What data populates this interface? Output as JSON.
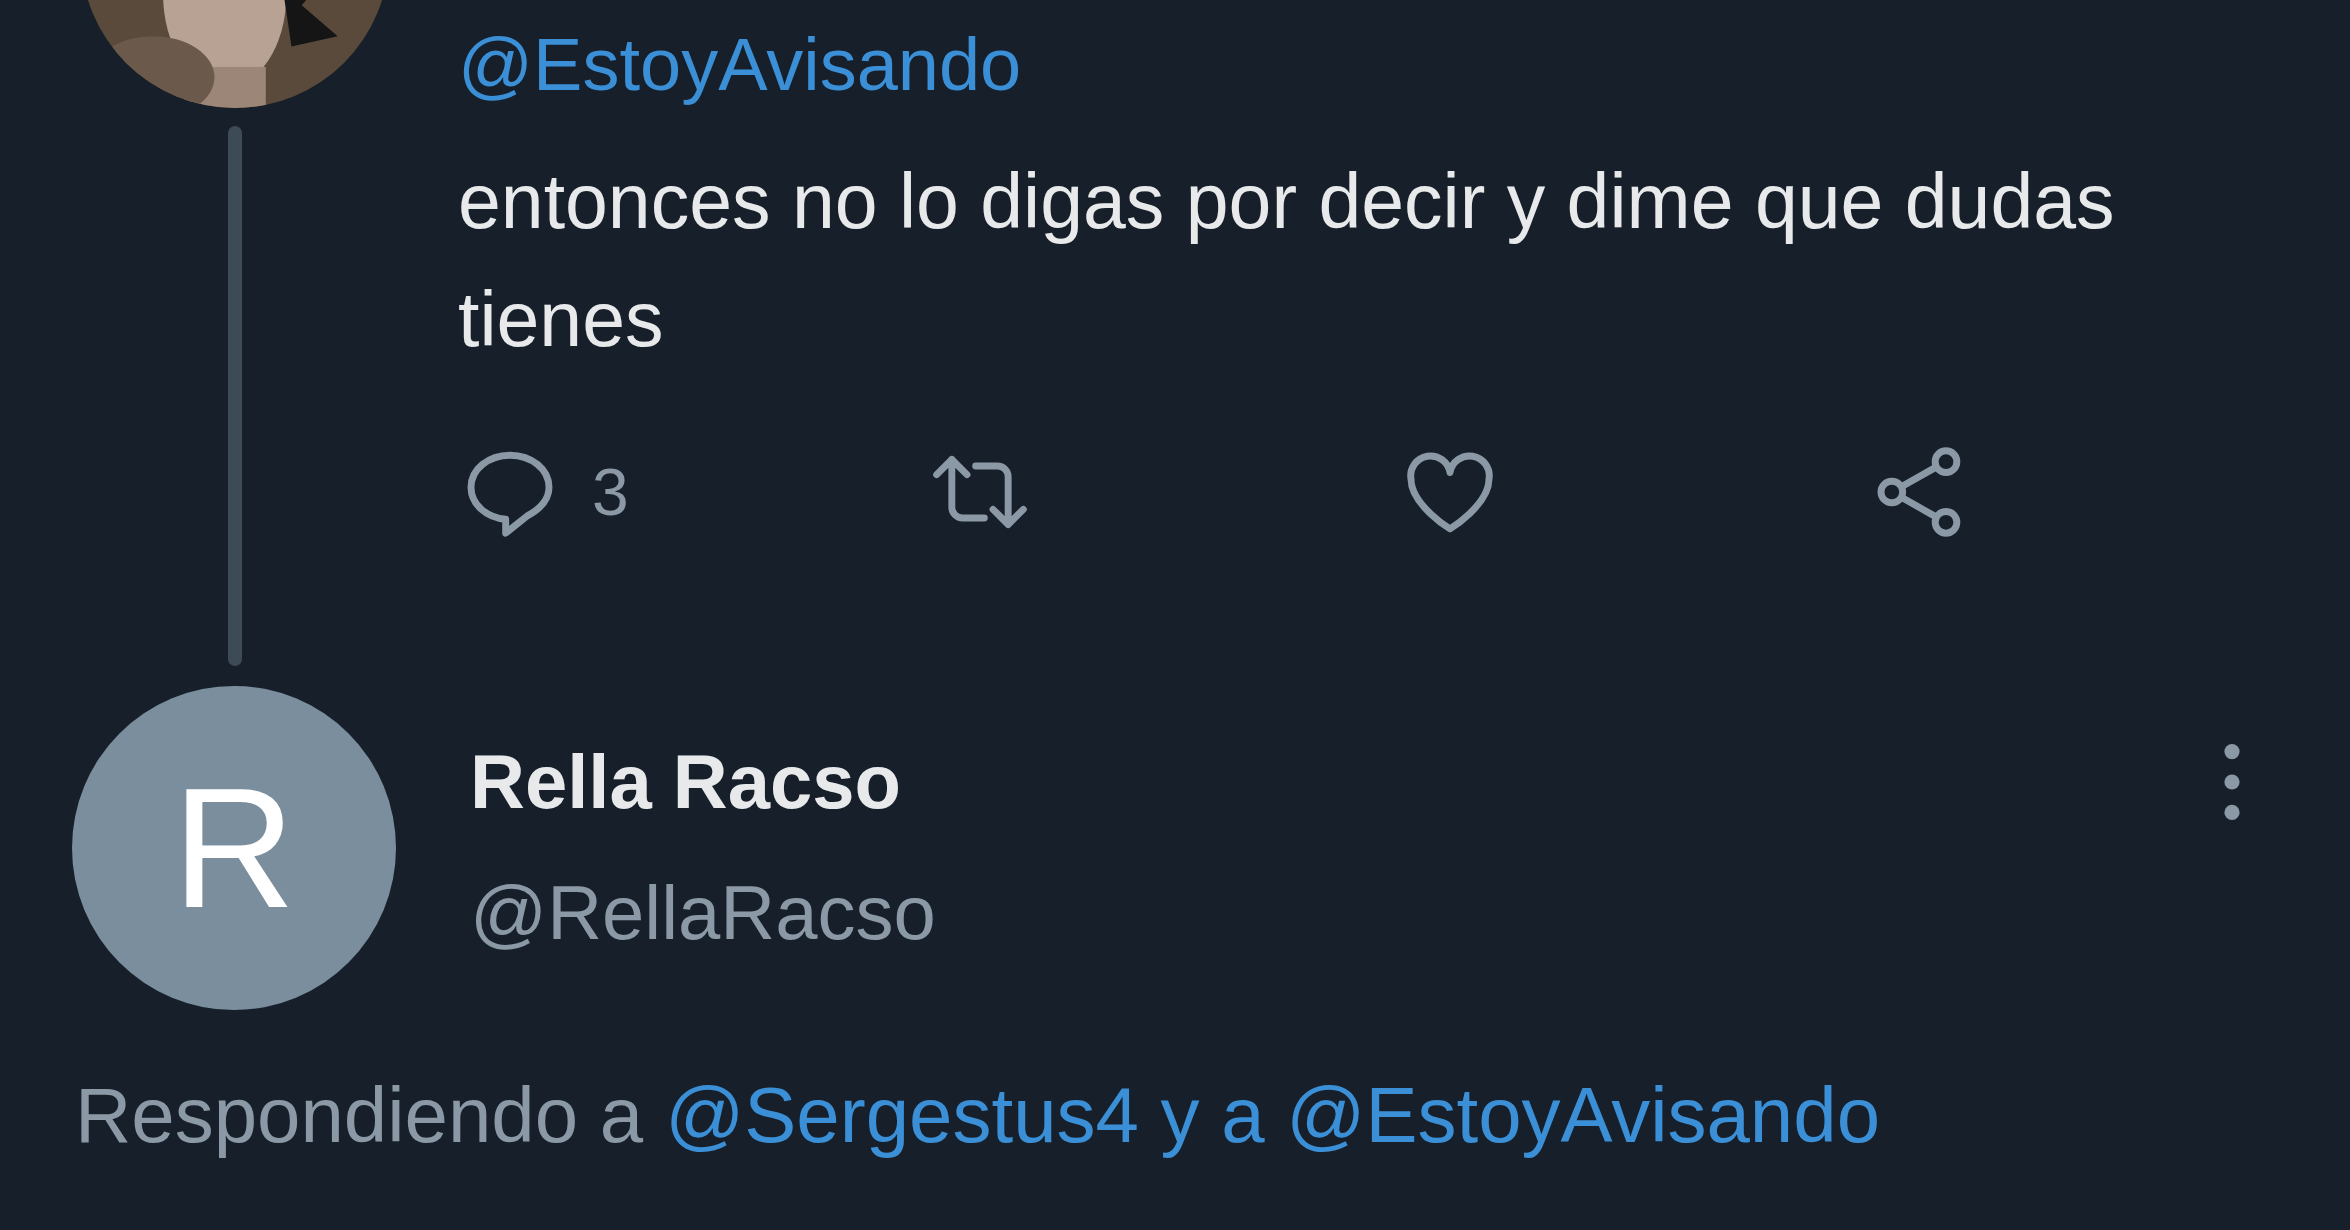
{
  "tweet": {
    "handle": "@EstoyAvisando",
    "text": "entonces no lo digas por decir y dime que dudas tienes",
    "actions": [
      {
        "kind": "reply",
        "count": "3"
      },
      {
        "kind": "retweet"
      },
      {
        "kind": "like"
      },
      {
        "kind": "share"
      }
    ]
  },
  "reply": {
    "avatar_letter": "R",
    "name": "Rella Racso",
    "handle": "@RellaRacso",
    "replying_prefix": "Respondiendo a",
    "replying_to": "@Sergestus4 y a @EstoyAvisando"
  }
}
